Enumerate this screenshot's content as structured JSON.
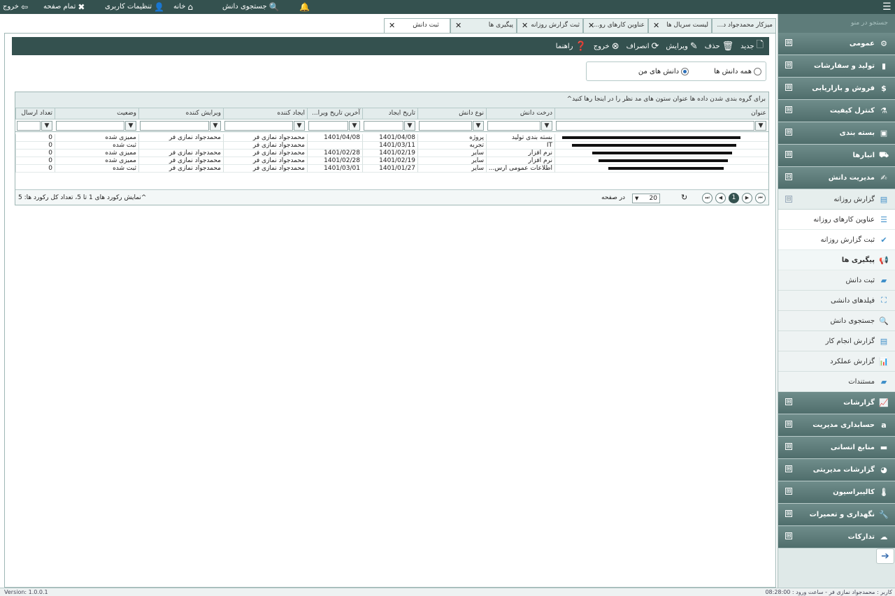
{
  "topbar": {
    "hamburger": "☰",
    "exit": "خروج",
    "fullscreen": "تمام صفحه",
    "user_settings": "تنظیمات کاربری",
    "home": "خانه",
    "knowledge_search": "جستجوی دانش"
  },
  "sidebar": {
    "search_placeholder": "جستجو در منو",
    "groups": [
      {
        "label": "عمومی",
        "icon": "gears-icon",
        "glyph": "⚙"
      },
      {
        "label": "تولید و سفارشات",
        "icon": "document-icon",
        "glyph": "▮"
      },
      {
        "label": "فروش و بازاریابی",
        "icon": "dollar-icon",
        "glyph": "$"
      },
      {
        "label": "کنترل کیفیت",
        "icon": "flask-icon",
        "glyph": "⚗"
      },
      {
        "label": "بسته بندی",
        "icon": "package-icon",
        "glyph": "▣"
      },
      {
        "label": "انبارها",
        "icon": "truck-icon",
        "glyph": "⛟"
      },
      {
        "label": "مدیریت دانش",
        "icon": "knowledge-icon",
        "glyph": "✍"
      }
    ],
    "daily_report": "گزارش روزانه",
    "daily_items": [
      "عناوین کارهای روزانه",
      "ثبت گزارش روزانه",
      "پیگیری ها"
    ],
    "knowledge_items": [
      "ثبت دانش",
      "فیلدهای دانشی",
      "جستجوی دانش",
      "گزارش انجام کار",
      "گزارش عملکرد",
      "مستندات"
    ],
    "groups2": [
      {
        "label": "گزارشات",
        "icon": "chart-line-icon",
        "glyph": "📈"
      },
      {
        "label": "حسابداری مدیریت",
        "icon": "accounting-icon",
        "glyph": "a"
      },
      {
        "label": "منابع انسانی",
        "icon": "hr-icon",
        "glyph": "▬"
      },
      {
        "label": "گزارشات مدیریتی",
        "icon": "dashboard-icon",
        "glyph": "◕"
      },
      {
        "label": "کالیبراسیون",
        "icon": "thermometer-icon",
        "glyph": "🌡"
      },
      {
        "label": "نگهداری و تعمیرات",
        "icon": "wrench-icon",
        "glyph": "🔧"
      },
      {
        "label": "تدارکات",
        "icon": "cloud-icon",
        "glyph": "☁"
      }
    ],
    "plus": "⊞",
    "minus": "⊟"
  },
  "tabs": [
    {
      "label": "میزکار محمدجواد د...",
      "active": false
    },
    {
      "label": "لیست سریال ها",
      "active": false
    },
    {
      "label": "عناوین کارهای رو...",
      "active": false
    },
    {
      "label": "ثبت گزارش روزانه",
      "active": false
    },
    {
      "label": "پیگیری ها",
      "active": false
    },
    {
      "label": "ثبت دانش",
      "active": true
    }
  ],
  "toolbar": {
    "new": "جدید",
    "delete": "حذف",
    "edit": "ویرایش",
    "cancel": "انصراف",
    "exit": "خروج",
    "help": "راهنما"
  },
  "filter": {
    "all": "همه دانش ها",
    "mine": "دانش های من",
    "selected": "mine"
  },
  "grid": {
    "group_hint": "برای گروه بندی شدن داده ها عنوان ستون های مد نظر را در اینجا رها کنید^",
    "columns": [
      "عنوان",
      "درخت دانش",
      "نوع دانش",
      "تاریخ ایجاد",
      "آخرین تاریخ ویرا...",
      "ایجاد کننده",
      "ویرایش کننده",
      "وضعیت",
      "تعداد ارسال"
    ],
    "rows": [
      {
        "tree": "بسته بندی تولید",
        "type": "پروژه",
        "created": "1401/04/08",
        "modified": "1401/04/08",
        "creator": "محمدجواد نمازی فر",
        "editor": "محمدجواد نمازی فر",
        "status": "ممیزی شده",
        "sends": "0"
      },
      {
        "tree": "IT",
        "type": "تجربه",
        "created": "1401/03/11",
        "modified": "",
        "creator": "محمدجواد نمازی فر",
        "editor": "",
        "status": "ثبت شده",
        "sends": "0"
      },
      {
        "tree": "نرم افزار",
        "type": "سایر",
        "created": "1401/02/19",
        "modified": "1401/02/28",
        "creator": "محمدجواد نمازی فر",
        "editor": "محمدجواد نمازی فر",
        "status": "ممیزی شده",
        "sends": "0"
      },
      {
        "tree": "نرم افزار",
        "type": "سایر",
        "created": "1401/02/19",
        "modified": "1401/02/28",
        "creator": "محمدجواد نمازی فر",
        "editor": "محمدجواد نمازی فر",
        "status": "ممیزی شده",
        "sends": "0"
      },
      {
        "tree": "اطلاعات عمومی ارس...",
        "type": "سایر",
        "created": "1401/01/27",
        "modified": "1401/03/01",
        "creator": "محمدجواد نمازی فر",
        "editor": "محمدجواد نمازی فر",
        "status": "ثبت شده",
        "sends": "0"
      }
    ],
    "pager": {
      "current_page": "1",
      "page_size": "20",
      "per_page_label": "در صفحه",
      "summary": "^نمایش رکورد های 1 تا 5، تعداد کل رکورد ها: 5"
    }
  },
  "status": {
    "version": "Version: 1.0.0.1",
    "user": "کاربر : محمدجواد نمازی فر - ساعت ورود : 08:28:00"
  }
}
